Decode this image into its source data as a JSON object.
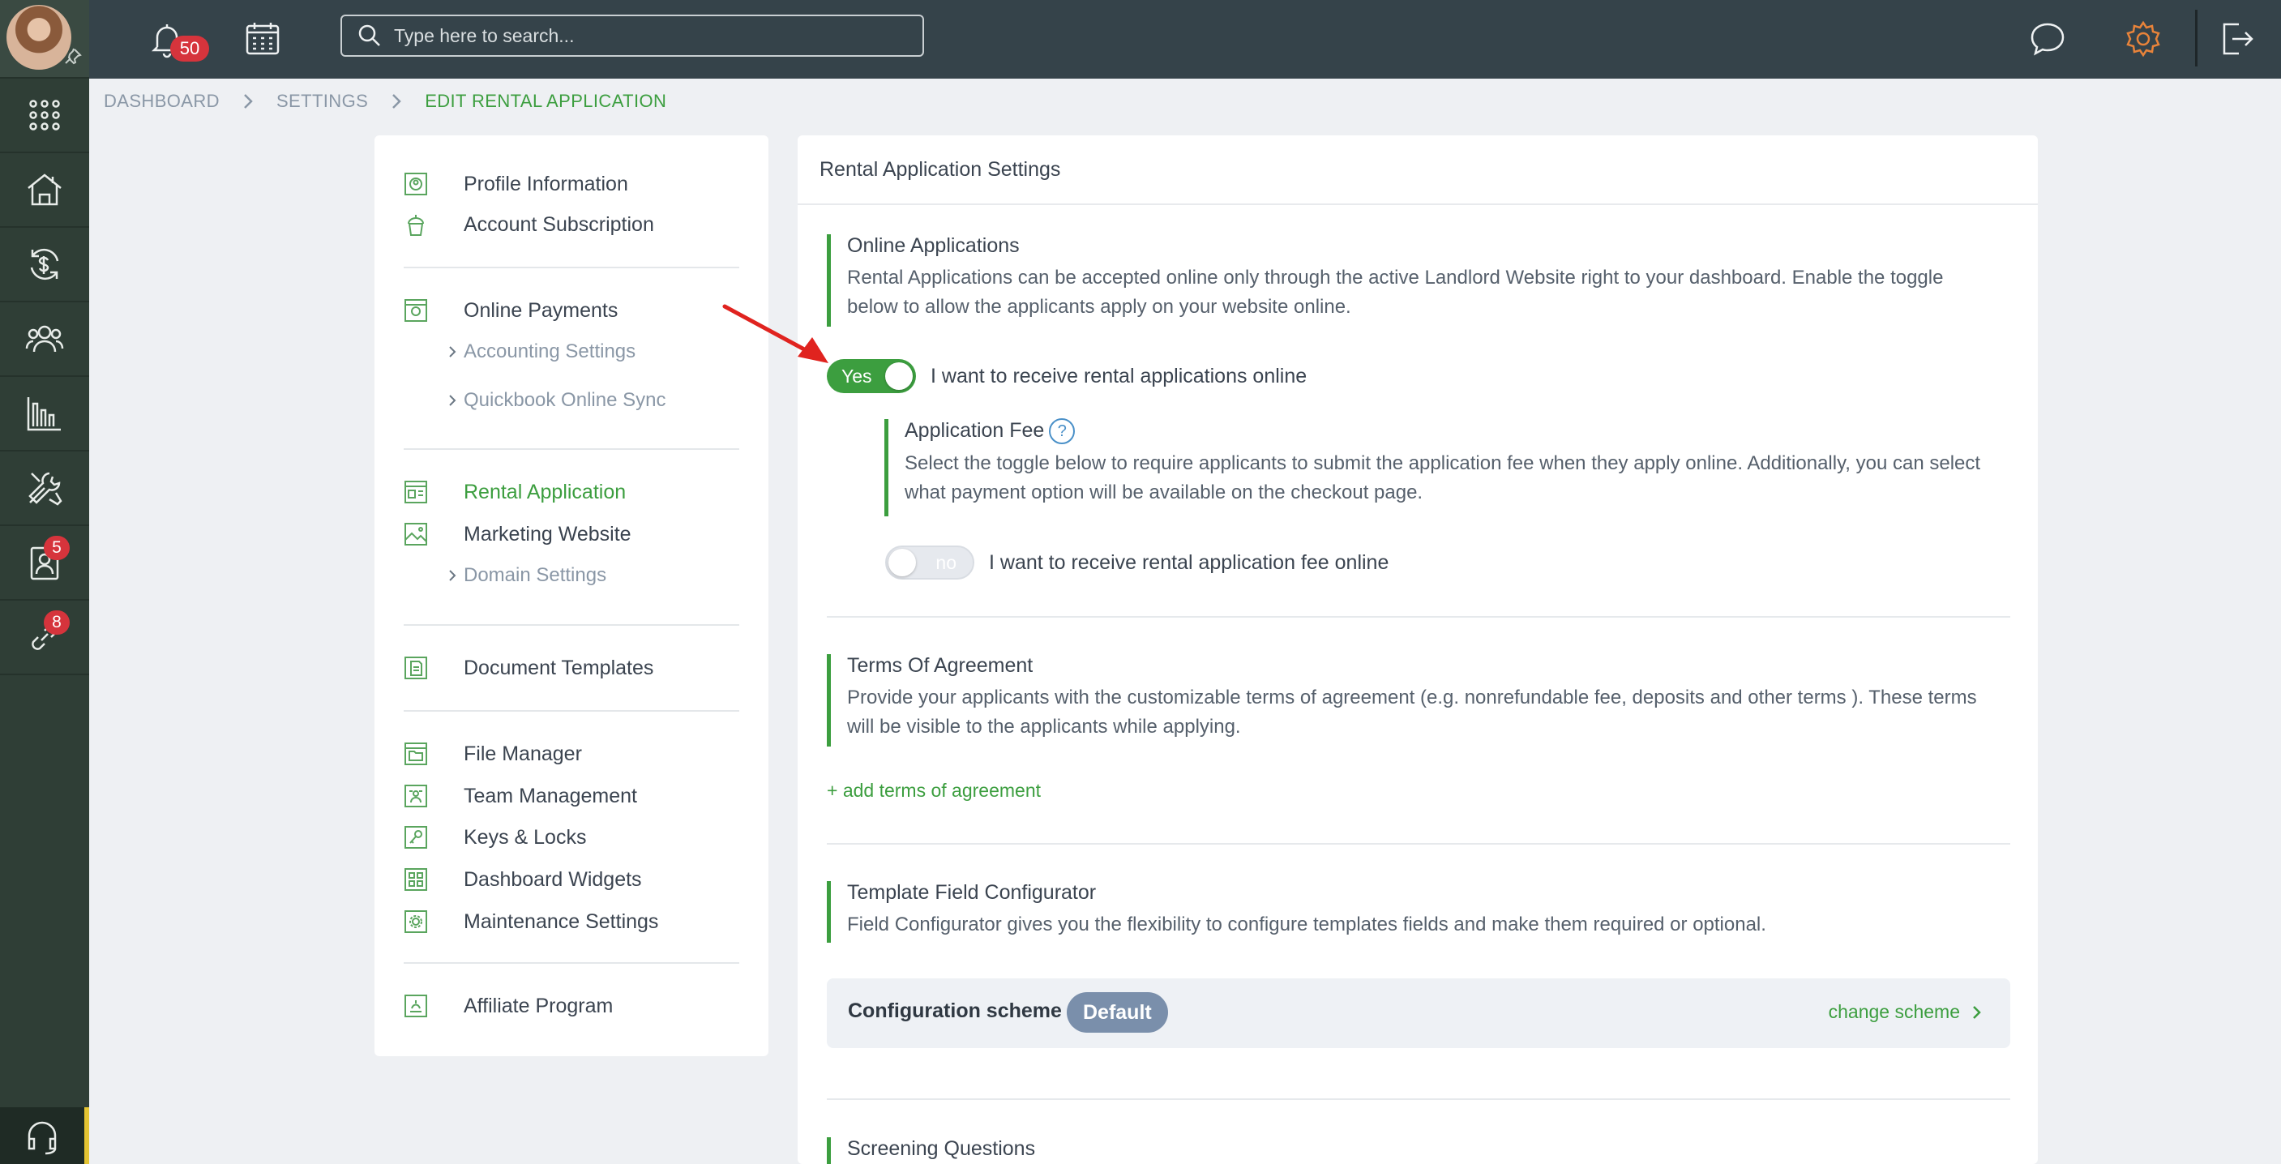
{
  "topbar": {
    "notifications_count": "50",
    "search_placeholder": "Type here to search..."
  },
  "rail": {
    "items": [
      {
        "icon": "apps-grid-icon"
      },
      {
        "icon": "properties-icon"
      },
      {
        "icon": "accounting-icon"
      },
      {
        "icon": "people-icon"
      },
      {
        "icon": "reports-icon"
      },
      {
        "icon": "maintenance-tools-icon"
      },
      {
        "icon": "applicants-icon",
        "badge": "5"
      },
      {
        "icon": "leads-icon",
        "badge": "8"
      }
    ],
    "bottom_icon": "support-headset-icon"
  },
  "breadcrumb": [
    "DASHBOARD",
    "SETTINGS",
    "EDIT RENTAL APPLICATION"
  ],
  "nav": {
    "profile_information": "Profile Information",
    "account_subscription": "Account Subscription",
    "online_payments": "Online Payments",
    "accounting_settings": "Accounting Settings",
    "quickbook_online_sync": "Quickbook Online Sync",
    "rental_application": "Rental Application",
    "marketing_website": "Marketing Website",
    "domain_settings": "Domain Settings",
    "document_templates": "Document Templates",
    "file_manager": "File Manager",
    "team_management": "Team Management",
    "keys_locks": "Keys & Locks",
    "dashboard_widgets": "Dashboard Widgets",
    "maintenance_settings": "Maintenance Settings",
    "affiliate_program": "Affiliate Program"
  },
  "panel": {
    "title": "Rental Application Settings",
    "online_applications": {
      "title": "Online Applications",
      "text": "Rental Applications can be accepted online only through the active Landlord Website right to your dashboard. Enable the toggle below to allow the applicants apply on your website online.",
      "toggle_label": "Yes",
      "toggle_text": "I want to receive rental applications online",
      "enabled": true
    },
    "application_fee": {
      "title": "Application Fee",
      "help": "?",
      "text": "Select the toggle below to require applicants to submit the application fee when they apply online. Additionally, you can select what payment option will be available on the checkout page.",
      "toggle_label": "no",
      "toggle_text": "I want to receive rental application fee online",
      "enabled": false
    },
    "terms": {
      "title": "Terms Of Agreement",
      "text": "Provide your applicants with the customizable terms of agreement (e.g. nonrefundable fee, deposits and other terms ). These terms will be visible to the applicants while applying.",
      "add_link": "+ add terms of agreement"
    },
    "template_fields": {
      "title": "Template Field Configurator",
      "text": "Field Configurator gives you the flexibility to configure templates fields and make them required or optional.",
      "scheme_label": "Configuration scheme",
      "scheme_value": "Default",
      "change_link": "change scheme"
    },
    "screening": {
      "title": "Screening Questions"
    }
  },
  "colors": {
    "accent": "#3c9e3f",
    "topbar": "#35434a",
    "rail": "#2f3e36",
    "badge": "#d6343c",
    "settings_icon": "#e8833a"
  }
}
